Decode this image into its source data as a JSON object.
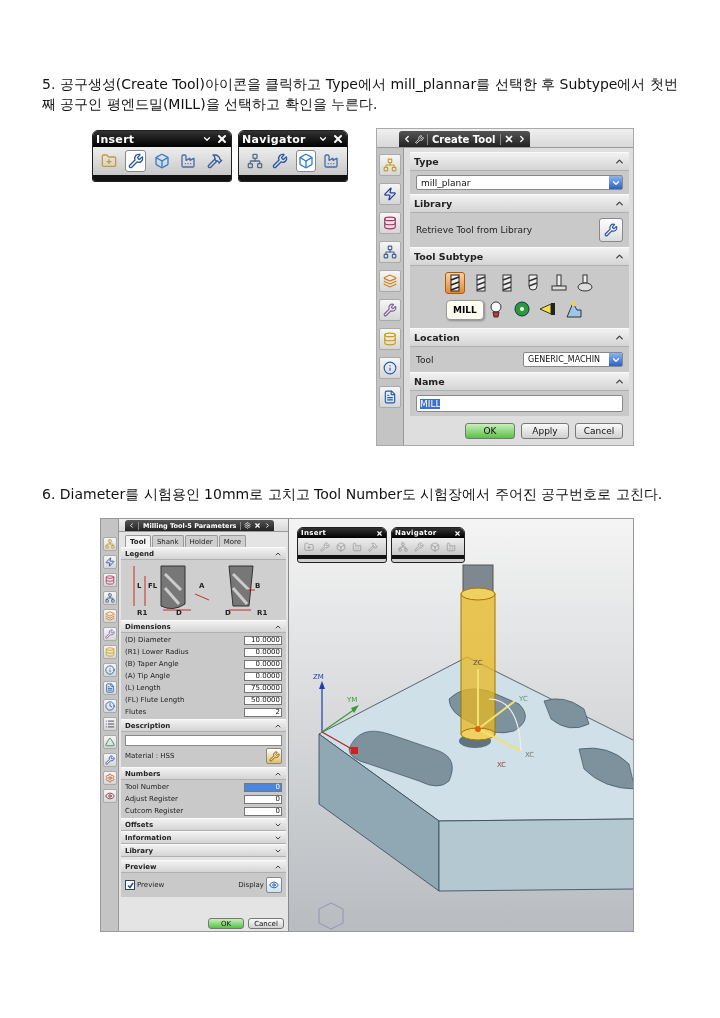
{
  "step5": {
    "instruction": "5. 공구생성(Create Tool)아이콘을 클릭하고 Type에서 mill_plannar를 선택한 후 Subtype에서 첫번째 공구인 평엔드밀(MILL)을 선택하고 확인을 누른다.",
    "toolbars": [
      {
        "title": "Insert",
        "buttons": [
          {
            "selected": false
          },
          {
            "selected": true
          },
          {
            "selected": false
          },
          {
            "selected": false
          },
          {
            "selected": false
          }
        ]
      },
      {
        "title": "Navigator",
        "buttons": [
          {
            "selected": false
          },
          {
            "selected": false
          },
          {
            "selected": true
          },
          {
            "selected": false
          }
        ]
      }
    ],
    "create_tool": {
      "title": "Create Tool",
      "type": {
        "label": "Type",
        "expanded": true,
        "value": "mill_planar"
      },
      "library": {
        "label": "Library",
        "expanded": true,
        "text": "Retrieve Tool from Library"
      },
      "subtype": {
        "label": "Tool Subtype",
        "expanded": true,
        "tooltip": "MILL",
        "items": [
          {
            "kind": "end-mill",
            "selected": true
          },
          {
            "kind": "end-mill",
            "selected": false
          },
          {
            "kind": "end-mill",
            "selected": false
          },
          {
            "kind": "ball-mill",
            "selected": false
          },
          {
            "kind": "t-cutter",
            "selected": false
          },
          {
            "kind": "barrel",
            "selected": false
          },
          {
            "kind": "thread",
            "selected": false
          },
          {
            "kind": "gear",
            "selected": false
          },
          {
            "kind": "probe",
            "selected": false
          },
          {
            "kind": "holder",
            "selected": false
          }
        ]
      },
      "location": {
        "label": "Location",
        "expanded": true,
        "field_label": "Tool",
        "value": "GENERIC_MACHIN"
      },
      "name": {
        "label": "Name",
        "expanded": true,
        "value": "MILL",
        "highlighted": true
      },
      "buttons": [
        "OK",
        "Apply",
        "Cancel"
      ]
    }
  },
  "step6": {
    "instruction": "6. Diameter를 시험용인 10mm로 고치고 Tool Number도 시험장에서 주어진 공구번호로 고친다.",
    "parameters": {
      "title": "Milling Tool-5 Parameters",
      "tabs": [
        {
          "label": "Tool",
          "selected": true
        },
        {
          "label": "Shank",
          "selected": false
        },
        {
          "label": "Holder",
          "selected": false
        },
        {
          "label": "More",
          "selected": false
        }
      ],
      "legend": {
        "label": "Legend",
        "expanded": true,
        "labels": [
          "L",
          "FL",
          "A",
          "B",
          "R1",
          "D",
          "D",
          "R1"
        ]
      },
      "dimensions": {
        "label": "Dimensions",
        "expanded": true,
        "rows": [
          {
            "label": "(D) Diameter",
            "value": "10.0000"
          },
          {
            "label": "(R1) Lower Radius",
            "value": "0.0000"
          },
          {
            "label": "(B) Taper Angle",
            "value": "0.0000"
          },
          {
            "label": "(A) Tip Angle",
            "value": "0.0000"
          },
          {
            "label": "(L) Length",
            "value": "75.0000"
          },
          {
            "label": "(FL) Flute Length",
            "value": "50.0000"
          },
          {
            "label": "Flutes",
            "value": "2"
          }
        ]
      },
      "description": {
        "label": "Description",
        "expanded": true,
        "material": "Material : HSS"
      },
      "numbers": {
        "label": "Numbers",
        "expanded": true,
        "rows": [
          {
            "label": "Tool Number",
            "value": "0",
            "highlighted": true
          },
          {
            "label": "Adjust Register",
            "value": "0",
            "highlighted": false
          },
          {
            "label": "Cutcom Register",
            "value": "0",
            "highlighted": false
          }
        ]
      },
      "collapsed_sections": [
        {
          "label": "Offsets",
          "expanded": false
        },
        {
          "label": "Information",
          "expanded": false
        },
        {
          "label": "Library",
          "expanded": false
        }
      ],
      "preview": {
        "label": "Preview",
        "expanded": true,
        "checkbox": {
          "label": "Preview",
          "checked": true
        },
        "display_label": "Display"
      },
      "buttons": [
        "OK",
        "Cancel"
      ]
    },
    "viewport": {
      "toolbars": [
        {
          "title": "Insert"
        },
        {
          "title": "Navigator"
        }
      ],
      "axis_labels": {
        "zm": "ZM",
        "ym": "YM",
        "zc": "ZC",
        "yc": "YC",
        "xc_near": "XC",
        "xc_far": "XC"
      }
    }
  }
}
